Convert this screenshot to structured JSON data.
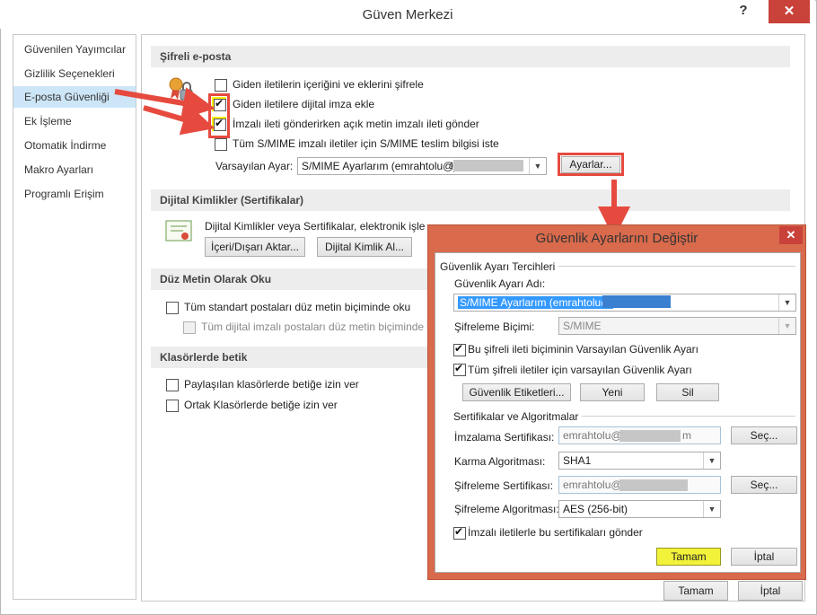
{
  "window": {
    "title": "Güven Merkezi",
    "help": "?",
    "close": "✕"
  },
  "sidebar": {
    "items": [
      {
        "label": "Güvenilen Yayımcılar"
      },
      {
        "label": "Gizlilik Seçenekleri"
      },
      {
        "label": "E-posta Güvenliği"
      },
      {
        "label": "Ek İşleme"
      },
      {
        "label": "Otomatik İndirme"
      },
      {
        "label": "Makro Ayarları"
      },
      {
        "label": "Programlı Erişim"
      }
    ],
    "active_index": 2
  },
  "encrypted_email": {
    "header": "Şifreli e-posta",
    "options": [
      {
        "label": "Giden iletilerin içeriğini ve eklerini şifrele",
        "checked": false
      },
      {
        "label": "Giden iletilere dijital imza ekle",
        "checked": true
      },
      {
        "label": "İmzalı ileti gönderirken açık metin imzalı ileti gönder",
        "checked": true
      },
      {
        "label": "Tüm S/MIME imzalı iletiler için S/MIME teslim bilgisi iste",
        "checked": false
      }
    ],
    "default_setting_label": "Varsayılan Ayar:",
    "default_setting_value": "S/MIME Ayarlarım (emrahtolu@",
    "default_setting_suffix": "l)",
    "settings_button": "Ayarlar..."
  },
  "digital_ids": {
    "header": "Dijital Kimlikler (Sertifikalar)",
    "description": "Dijital Kimlikler veya Sertifikalar, elektronik işlemlerde kimliğinizi kanıtlamanızı sağlayan belgelerdir.",
    "import_export_button": "İçeri/Dışarı Aktar...",
    "get_id_button": "Dijital Kimlik Al..."
  },
  "plain_text": {
    "header": "Düz Metin Olarak Oku",
    "options": [
      {
        "label": "Tüm standart postaları düz metin biçiminde oku",
        "checked": false
      },
      {
        "label": "Tüm dijital imzalı postaları düz metin biçiminde oku",
        "checked": false
      }
    ]
  },
  "folder_script": {
    "header": "Klasörlerde betik",
    "options": [
      {
        "label": "Paylaşılan klasörlerde betiğe izin ver",
        "checked": false
      },
      {
        "label": "Ortak Klasörlerde betiğe izin ver",
        "checked": false
      }
    ]
  },
  "footer": {
    "ok": "Tamam",
    "cancel": "İptal"
  },
  "dialog": {
    "title": "Güvenlik Ayarlarını Değiştir",
    "close": "✕",
    "prefs_group": "Güvenlik Ayarı Tercihleri",
    "name_label": "Güvenlik Ayarı Adı:",
    "name_value": "S/MIME Ayarlarım (emrahtolu@",
    "format_label": "Şifreleme Biçimi:",
    "format_value": "S/MIME",
    "default_format_check": {
      "label": "Bu şifreli ileti biçiminin Varsayılan Güvenlik Ayarı",
      "checked": true
    },
    "default_all_check": {
      "label": "Tüm şifreli iletiler için varsayılan Güvenlik Ayarı",
      "checked": true
    },
    "security_labels_button": "Güvenlik Etiketleri...",
    "new_button": "Yeni",
    "delete_button": "Sil",
    "certs_group": "Sertifikalar ve Algoritmalar",
    "signing_cert_label": "İmzalama Sertifikası:",
    "signing_cert_value": "emrahtolu@",
    "signing_cert_suffix": "m",
    "choose1": "Seç...",
    "hash_label": "Karma Algoritması:",
    "hash_value": "SHA1",
    "enc_cert_label": "Şifreleme Sertifikası:",
    "enc_cert_value": "emrahtolu@",
    "choose2": "Seç...",
    "enc_alg_label": "Şifreleme Algoritması:",
    "enc_alg_value": "AES (256-bit)",
    "send_certs_check": {
      "label": "İmzalı iletilerle bu sertifikaları gönder",
      "checked": true
    },
    "ok": "Tamam",
    "cancel": "İptal"
  },
  "colors": {
    "highlight_red": "#e64a3f",
    "highlight_yellow": "#fff200",
    "dialog_frame": "#d96a4c",
    "selection": "#3399ff",
    "close_button": "#c9423a"
  }
}
